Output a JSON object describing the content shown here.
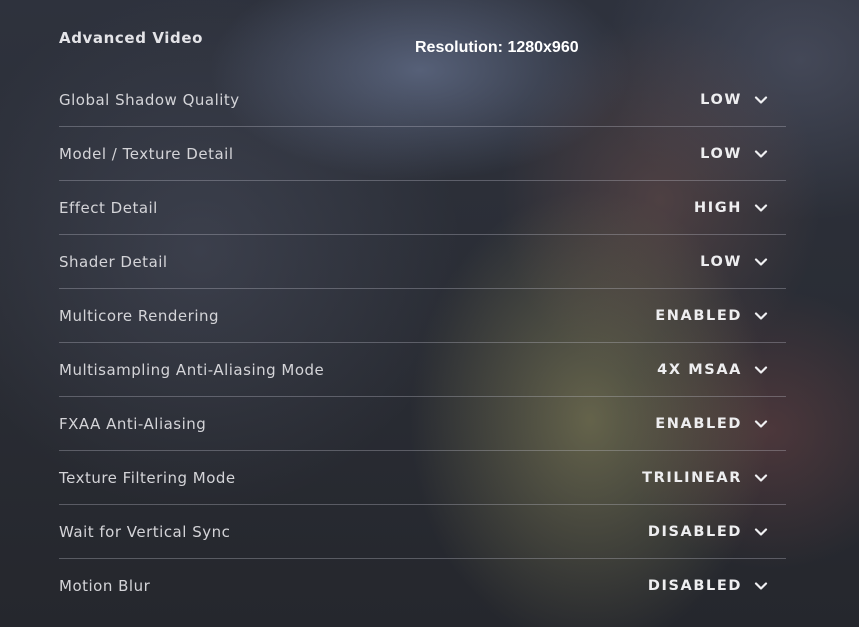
{
  "panel": {
    "title": "Advanced Video",
    "resolution_text": "Resolution: 1280x960"
  },
  "settings": [
    {
      "label": "Global Shadow Quality",
      "value": "LOW",
      "icon": "chevron-down-icon"
    },
    {
      "label": "Model / Texture Detail",
      "value": "LOW",
      "icon": "chevron-down-icon"
    },
    {
      "label": "Effect Detail",
      "value": "HIGH",
      "icon": "chevron-down-icon"
    },
    {
      "label": "Shader Detail",
      "value": "LOW",
      "icon": "chevron-down-icon"
    },
    {
      "label": "Multicore Rendering",
      "value": "ENABLED",
      "icon": "chevron-down-icon"
    },
    {
      "label": "Multisampling Anti-Aliasing Mode",
      "value": "4X MSAA",
      "icon": "chevron-down-icon"
    },
    {
      "label": "FXAA Anti-Aliasing",
      "value": "ENABLED",
      "icon": "chevron-down-icon"
    },
    {
      "label": "Texture Filtering Mode",
      "value": "TRILINEAR",
      "icon": "chevron-down-icon"
    },
    {
      "label": "Wait for Vertical Sync",
      "value": "DISABLED",
      "icon": "chevron-down-icon"
    },
    {
      "label": "Motion Blur",
      "value": "DISABLED",
      "icon": "chevron-down-icon"
    }
  ]
}
